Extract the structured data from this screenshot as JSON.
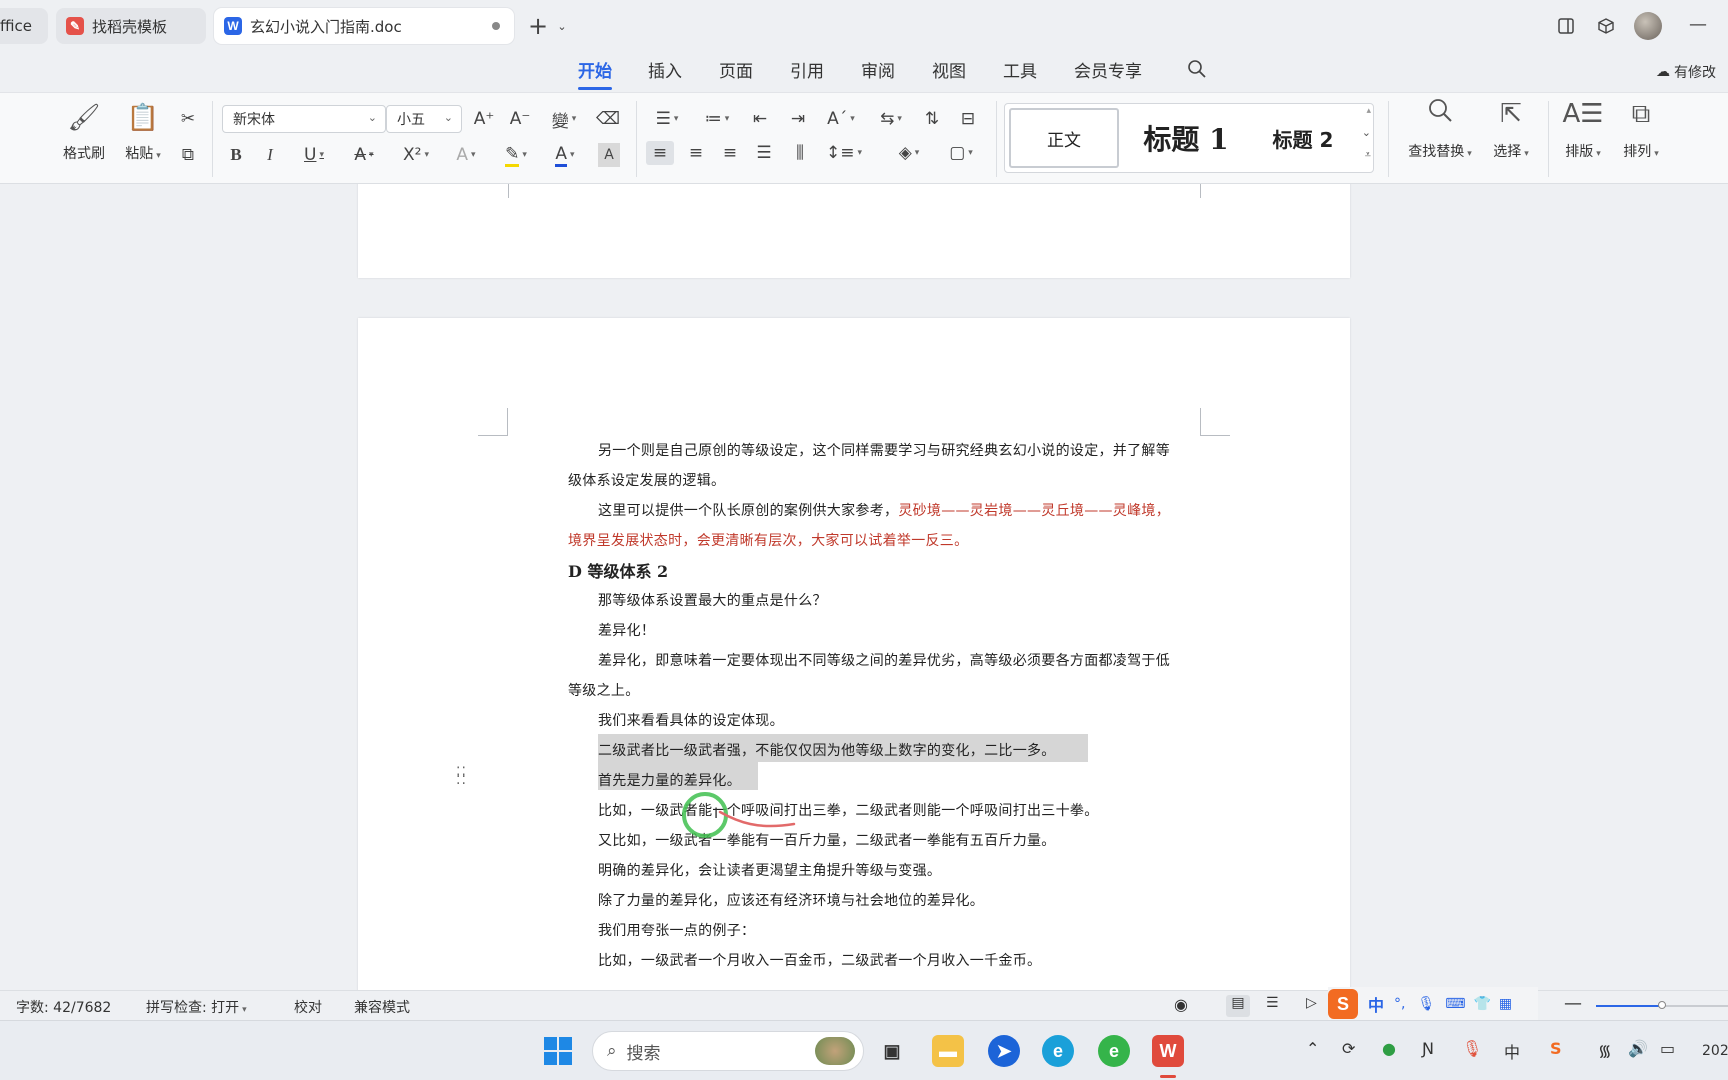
{
  "tabs": {
    "office_fragment": "ffice",
    "template_tab": "找稻壳模板",
    "doc_tab": "玄幻小说入门指南.doc",
    "new_tab": "+"
  },
  "menu": {
    "items": [
      "开始",
      "插入",
      "页面",
      "引用",
      "审阅",
      "视图",
      "工具",
      "会员专享"
    ],
    "active": "开始",
    "right_label": "有修改"
  },
  "ribbon": {
    "format_painter": "格式刷",
    "paste": "粘贴",
    "font_name": "新宋体",
    "font_size": "小五",
    "style_normal": "正文",
    "style_h1": "标题 1",
    "style_h2": "标题 2",
    "find_replace": "查找替换",
    "select": "选择",
    "layout": "排版",
    "arrange": "排列"
  },
  "document": {
    "p1_line1": "另一个则是自己原创的等级设定，这个同样需要学习与研究经典玄幻小说的设定，并了解等",
    "p1_line2": "级体系设定发展的逻辑。",
    "p2_line1_black": "这里可以提供一个队长原创的案例供大家参考，",
    "p2_line1_red": "灵砂境——灵岩境——灵丘境——灵峰境，",
    "p2_line2_red": "境界呈发展状态时，会更清晰有层次，大家可以试着举一反三。",
    "heading": "D 等级体系 2",
    "p3": "那等级体系设置最大的重点是什么？",
    "p4": "差异化！",
    "p5_line1": "差异化，即意味着一定要体现出不同等级之间的差异优劣，高等级必须要各方面都凌驾于低",
    "p5_line2": "等级之上。",
    "p6": "我们来看看具体的设定体现。",
    "p7": "二级武者比一级武者强，不能仅仅因为他等级上数字的变化，二比一多。",
    "p8": "首先是力量的差异化。",
    "p9": "比如，一级武者能一个呼吸间打出三拳，二级武者则能一个呼吸间打出三十拳。",
    "p10": "又比如，一级武者一拳能有一百斤力量，二级武者一拳能有五百斤力量。",
    "p11": "明确的差异化，会让读者更渴望主角提升等级与变强。",
    "p12": "除了力量的差异化，应该还有经济环境与社会地位的差异化。",
    "p13": "我们用夸张一点的例子：",
    "p14": "比如，一级武者一个月收入一百金币，二级武者一个月收入一千金币。"
  },
  "status": {
    "word_count": "字数: 42/7682",
    "spell_check": "拼写检查: 打开",
    "proofread": "校对",
    "compat_mode": "兼容模式"
  },
  "ime": {
    "lang": "中",
    "punct": "°,"
  },
  "taskbar": {
    "search_placeholder": "搜索",
    "tray_lang": "中",
    "clock_fragment": "202"
  },
  "colors": {
    "accent": "#2b66e6",
    "doc_red": "#c0392b",
    "wps_red": "#e04a3c"
  }
}
